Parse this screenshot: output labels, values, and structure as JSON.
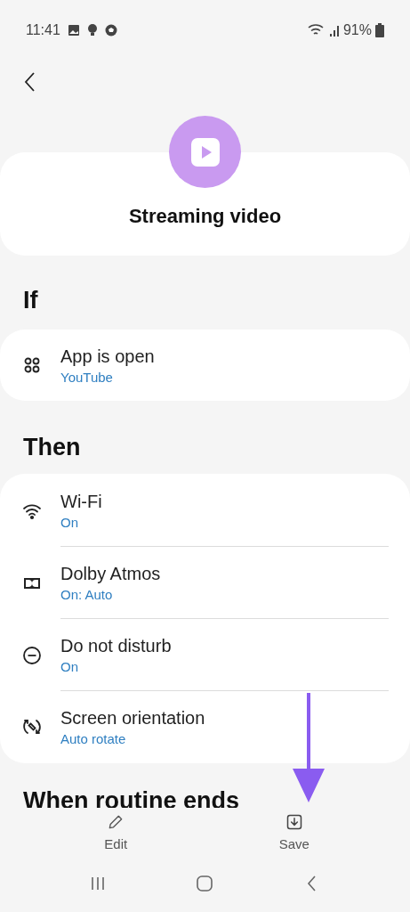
{
  "status_bar": {
    "time": "11:41",
    "battery": "91%"
  },
  "routine": {
    "title": "Streaming video"
  },
  "if_section": {
    "heading": "If",
    "items": [
      {
        "kind": "apps",
        "title": "App is open",
        "value": "YouTube"
      }
    ]
  },
  "then_section": {
    "heading": "Then",
    "items": [
      {
        "kind": "wifi",
        "title": "Wi-Fi",
        "value": "On"
      },
      {
        "kind": "dolby",
        "title": "Dolby Atmos",
        "value": "On: Auto"
      },
      {
        "kind": "dnd",
        "title": "Do not disturb",
        "value": "On"
      },
      {
        "kind": "rotate",
        "title": "Screen orientation",
        "value": "Auto rotate"
      }
    ]
  },
  "ends_section": {
    "heading": "When routine ends"
  },
  "bottom_actions": [
    {
      "kind": "edit",
      "label": "Edit"
    },
    {
      "kind": "save",
      "label": "Save"
    }
  ]
}
